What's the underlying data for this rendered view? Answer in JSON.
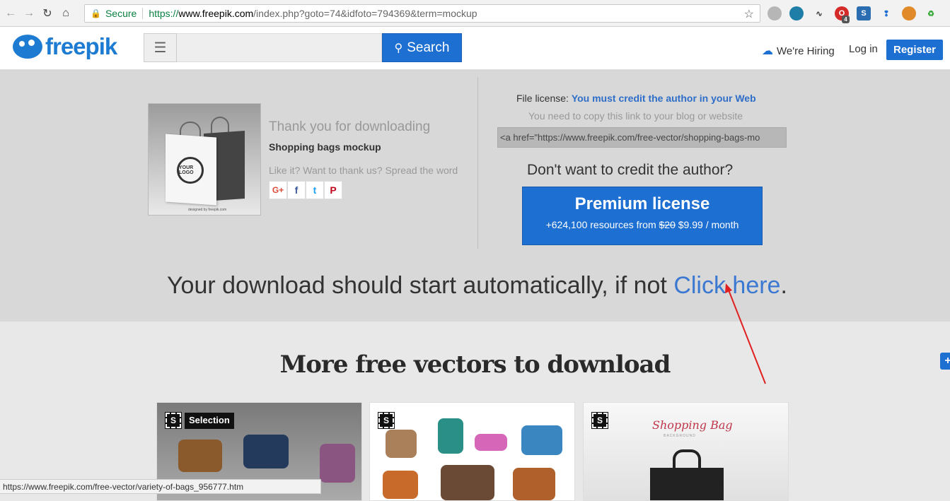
{
  "browser": {
    "secure_label": "Secure",
    "url_scheme": "https://",
    "url_host": "www.freepik.com",
    "url_rest": "/index.php?goto=74&idfoto=794369&term=mockup",
    "extension_badge": "4",
    "status_url": "https://www.freepik.com/free-vector/variety-of-bags_956777.htm"
  },
  "header": {
    "logo_text": "freepik",
    "search_label": "Search",
    "hiring_label": "We're Hiring",
    "login_label": "Log in",
    "register_label": "Register"
  },
  "download": {
    "thumb_brand": "YOUR LOGO",
    "thumb_credit": "designed by freepik.com",
    "thank_you": "Thank you for downloading",
    "resource_name": "Shopping bags mockup",
    "spread_word": "Like it? Want to thank us? Spread the word",
    "share_buttons": [
      "G+",
      "f",
      "t",
      "P"
    ],
    "license_prefix": "File license: ",
    "license_text": "You must credit the author in your Web",
    "copy_hint": "You need to copy this link to your blog or website",
    "attribution_link": "<a href=\"https://www.freepik.com/free-vector/shopping-bags-mo",
    "dont_credit": "Don't want to credit the author?",
    "premium_title": "Premium license",
    "premium_prefix": "+624,100 resources from ",
    "premium_old_price": "$20",
    "premium_new_price": " $9.99 / month",
    "auto_text": "Your download should start automatically, if not ",
    "click_here": "Click here",
    "auto_end": "."
  },
  "more": {
    "title": "More free vectors to download",
    "selection_label": "Selection",
    "card3_title": "Shopping Bag",
    "card3_sub": "BACKGROUND"
  },
  "colors": {
    "brand_blue": "#1d6fd1",
    "link_blue": "#3b78d1",
    "annotation_red": "#e02020"
  }
}
